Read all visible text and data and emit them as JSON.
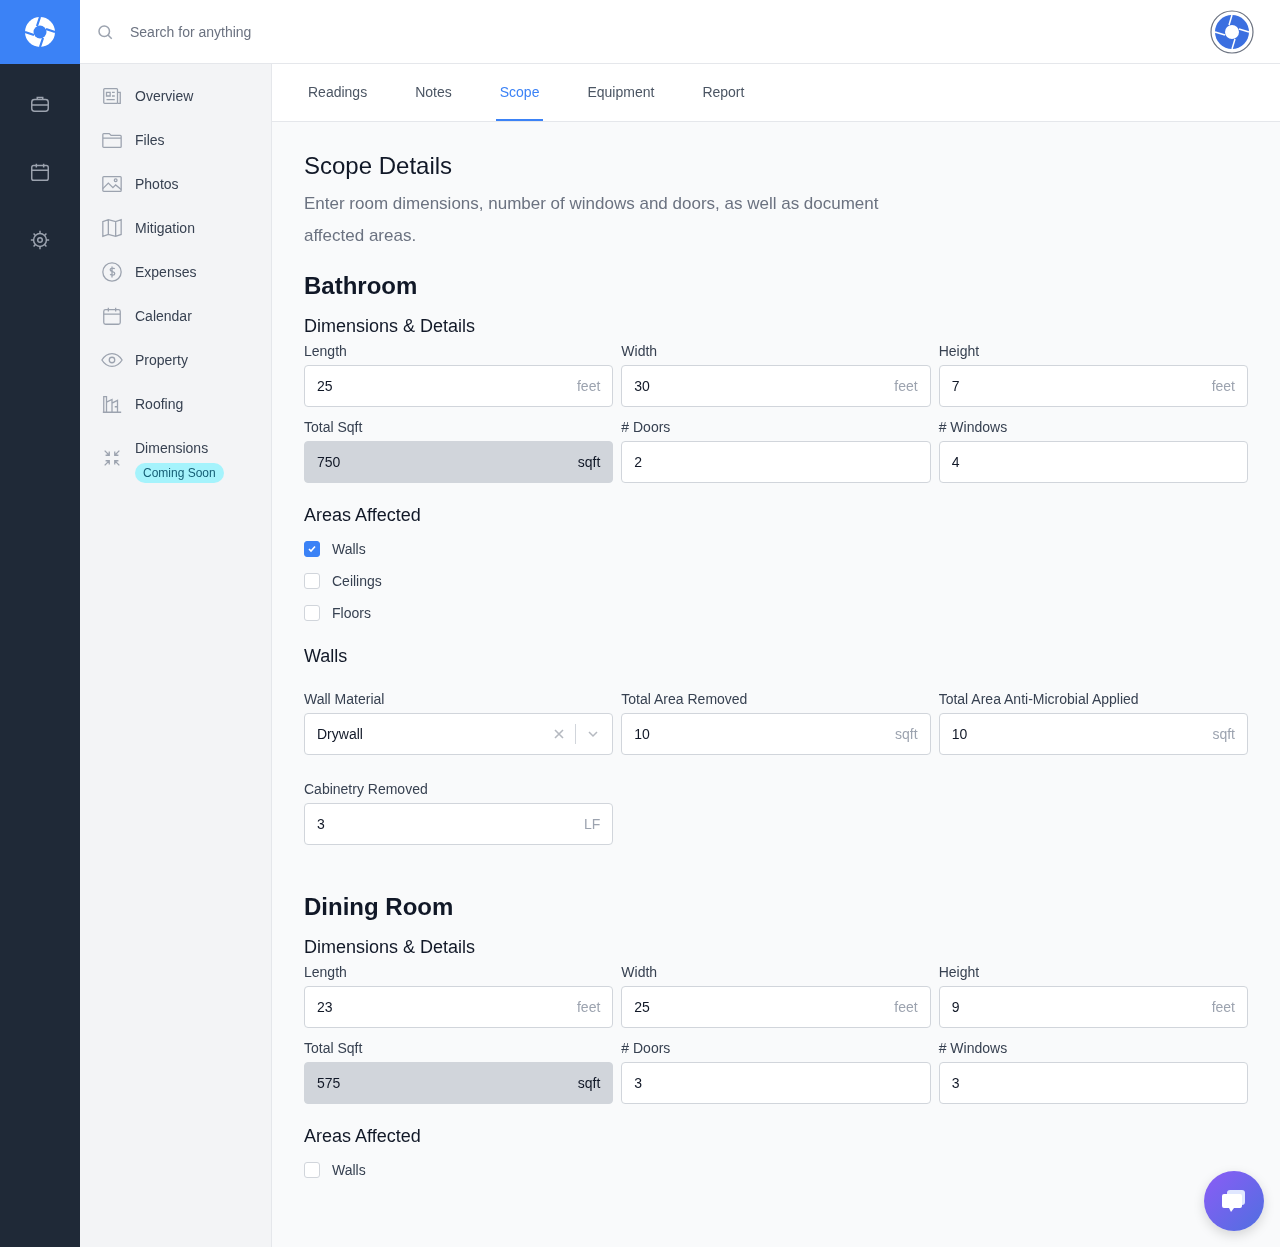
{
  "search": {
    "placeholder": "Search for anything"
  },
  "nav": [
    {
      "label": "Overview"
    },
    {
      "label": "Files"
    },
    {
      "label": "Photos"
    },
    {
      "label": "Mitigation"
    },
    {
      "label": "Expenses"
    },
    {
      "label": "Calendar"
    },
    {
      "label": "Property"
    },
    {
      "label": "Roofing"
    },
    {
      "label": "Dimensions",
      "badge": "Coming Soon"
    }
  ],
  "tabs": [
    {
      "label": "Readings",
      "selected": false
    },
    {
      "label": "Notes",
      "selected": false
    },
    {
      "label": "Scope",
      "selected": true
    },
    {
      "label": "Equipment",
      "selected": false
    },
    {
      "label": "Report",
      "selected": false
    }
  ],
  "title": "Scope Details",
  "intro": "Enter room dimensions, number of windows and doors, as well as document affected areas.",
  "rooms": [
    {
      "name": "Bathroom",
      "sections": [
        {
          "kind": "fields",
          "heading": "Dimensions & Details",
          "fields": [
            {
              "kind": "input",
              "label": "Length",
              "value": "25",
              "unit": "feet"
            },
            {
              "kind": "input",
              "label": "Width",
              "value": "30",
              "unit": "feet"
            },
            {
              "kind": "input",
              "label": "Height",
              "value": "7",
              "unit": "feet"
            },
            {
              "kind": "computed",
              "label": "Total Sqft",
              "value": "750",
              "unit": "sqft"
            },
            {
              "kind": "input",
              "label": "# Doors",
              "value": "2"
            },
            {
              "kind": "input",
              "label": "# Windows",
              "value": "4"
            }
          ]
        },
        {
          "kind": "checks",
          "heading": "Areas Affected",
          "items": [
            {
              "label": "Walls",
              "checked": true
            },
            {
              "label": "Ceilings",
              "checked": false
            },
            {
              "label": "Floors",
              "checked": false
            }
          ]
        },
        {
          "kind": "fields",
          "heading": "Walls",
          "fields": [
            {
              "kind": "select",
              "label": "Wall Material",
              "value": "Drywall"
            },
            {
              "kind": "input",
              "label": "Total Area Removed",
              "value": "10",
              "unit": "sqft"
            },
            {
              "kind": "input",
              "label": "Total Area Anti-Microbial Applied",
              "value": "10",
              "unit": "sqft"
            },
            {
              "kind": "input",
              "label": "Cabinetry Removed",
              "value": "3",
              "unit": "LF"
            }
          ]
        }
      ]
    },
    {
      "name": "Dining Room",
      "sections": [
        {
          "kind": "fields",
          "heading": "Dimensions & Details",
          "fields": [
            {
              "kind": "input",
              "label": "Length",
              "value": "23",
              "unit": "feet"
            },
            {
              "kind": "input",
              "label": "Width",
              "value": "25",
              "unit": "feet"
            },
            {
              "kind": "input",
              "label": "Height",
              "value": "9",
              "unit": "feet"
            },
            {
              "kind": "computed",
              "label": "Total Sqft",
              "value": "575",
              "unit": "sqft"
            },
            {
              "kind": "input",
              "label": "# Doors",
              "value": "3"
            },
            {
              "kind": "input",
              "label": "# Windows",
              "value": "3"
            }
          ]
        },
        {
          "kind": "checks",
          "heading": "Areas Affected",
          "items": [
            {
              "label": "Walls",
              "checked": false
            }
          ]
        }
      ]
    }
  ]
}
